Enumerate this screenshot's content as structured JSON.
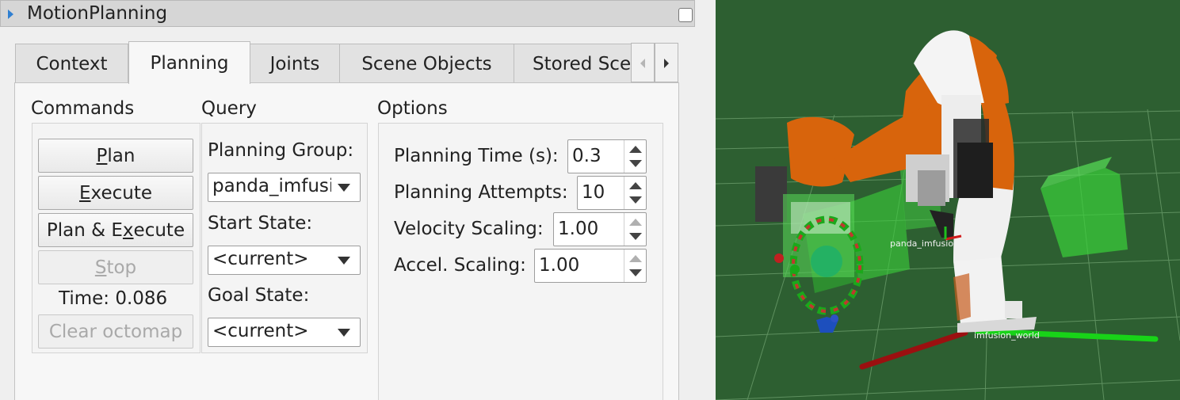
{
  "window": {
    "title": "MotionPlanning"
  },
  "tabs": [
    {
      "label": "Context",
      "active": false
    },
    {
      "label": "Planning",
      "active": true
    },
    {
      "label": "Joints",
      "active": false
    },
    {
      "label": "Scene Objects",
      "active": false
    },
    {
      "label": "Stored Sce",
      "active": false
    }
  ],
  "commands": {
    "title": "Commands",
    "plan": {
      "pre": "",
      "key": "P",
      "post": "lan"
    },
    "execute": {
      "pre": "",
      "key": "E",
      "post": "xecute"
    },
    "plan_execute": {
      "pre": "Plan & E",
      "key": "x",
      "post": "ecute"
    },
    "stop": {
      "pre": "",
      "key": "S",
      "post": "top"
    },
    "time": "Time: 0.086",
    "clear_octomap": "Clear octomap"
  },
  "query": {
    "title": "Query",
    "planning_group_label": "Planning Group:",
    "planning_group_value": "panda_imfusion",
    "start_state_label": "Start State:",
    "start_state_value": "<current>",
    "goal_state_label": "Goal State:",
    "goal_state_value": "<current>"
  },
  "options": {
    "title": "Options",
    "planning_time_label": "Planning Time (s):",
    "planning_time_value": "0.3",
    "planning_attempts_label": "Planning Attempts:",
    "planning_attempts_value": "10",
    "velocity_scaling_label": "Velocity Scaling:",
    "velocity_scaling_value": "1.00",
    "accel_scaling_label": "Accel. Scaling:",
    "accel_scaling_value": "1.00"
  },
  "view3d": {
    "tcp_frame_label": "panda_imfusion_hand_tcp",
    "world_frame_label": "imfusion_world",
    "background_color": "#2d5f31",
    "grid_color": "#6fa16f",
    "robot_orange": "#d8640c",
    "collision_green": "#3bd13b"
  }
}
